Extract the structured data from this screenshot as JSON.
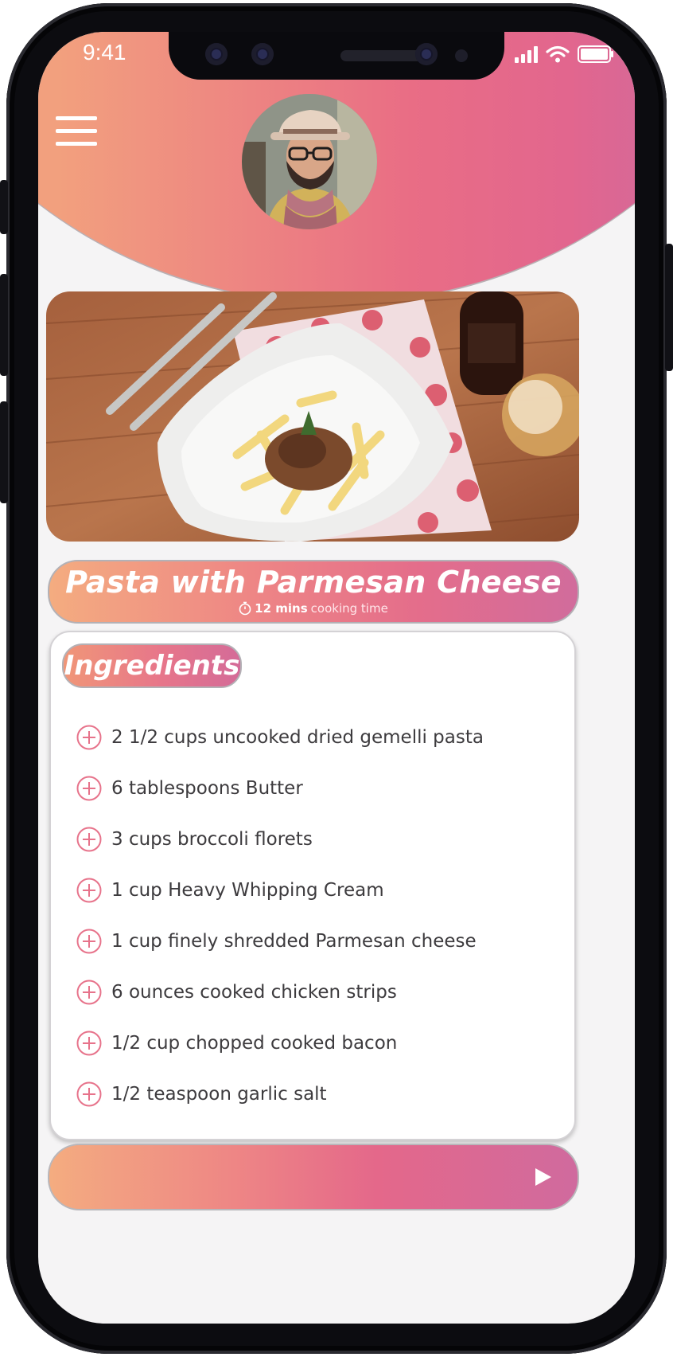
{
  "status_bar": {
    "time": "9:41"
  },
  "header": {
    "menu_icon": "hamburger-icon",
    "avatar": "user-avatar"
  },
  "recipe": {
    "title": "Pasta with Parmesan Cheese",
    "cook_time_value": "12 mins",
    "cook_time_label": "cooking time",
    "timer_icon": "stopwatch-icon"
  },
  "ingredients": {
    "heading": "Ingredients",
    "item_icon": "plus-circle-icon",
    "items": [
      "2 1/2 cups uncooked dried gemelli pasta",
      "6 tablespoons Butter",
      "3 cups broccoli florets",
      "1 cup Heavy Whipping Cream",
      "1 cup finely shredded Parmesan cheese",
      "6 ounces cooked chicken strips",
      "1/2 cup chopped cooked bacon",
      "1/2 teaspoon garlic salt"
    ]
  },
  "player": {
    "play_icon": "play-icon"
  },
  "colors": {
    "gradient_start": "#f4ac80",
    "gradient_mid": "#e96d85",
    "gradient_end": "#cb6aa0",
    "icon_pink": "#e7738b"
  }
}
